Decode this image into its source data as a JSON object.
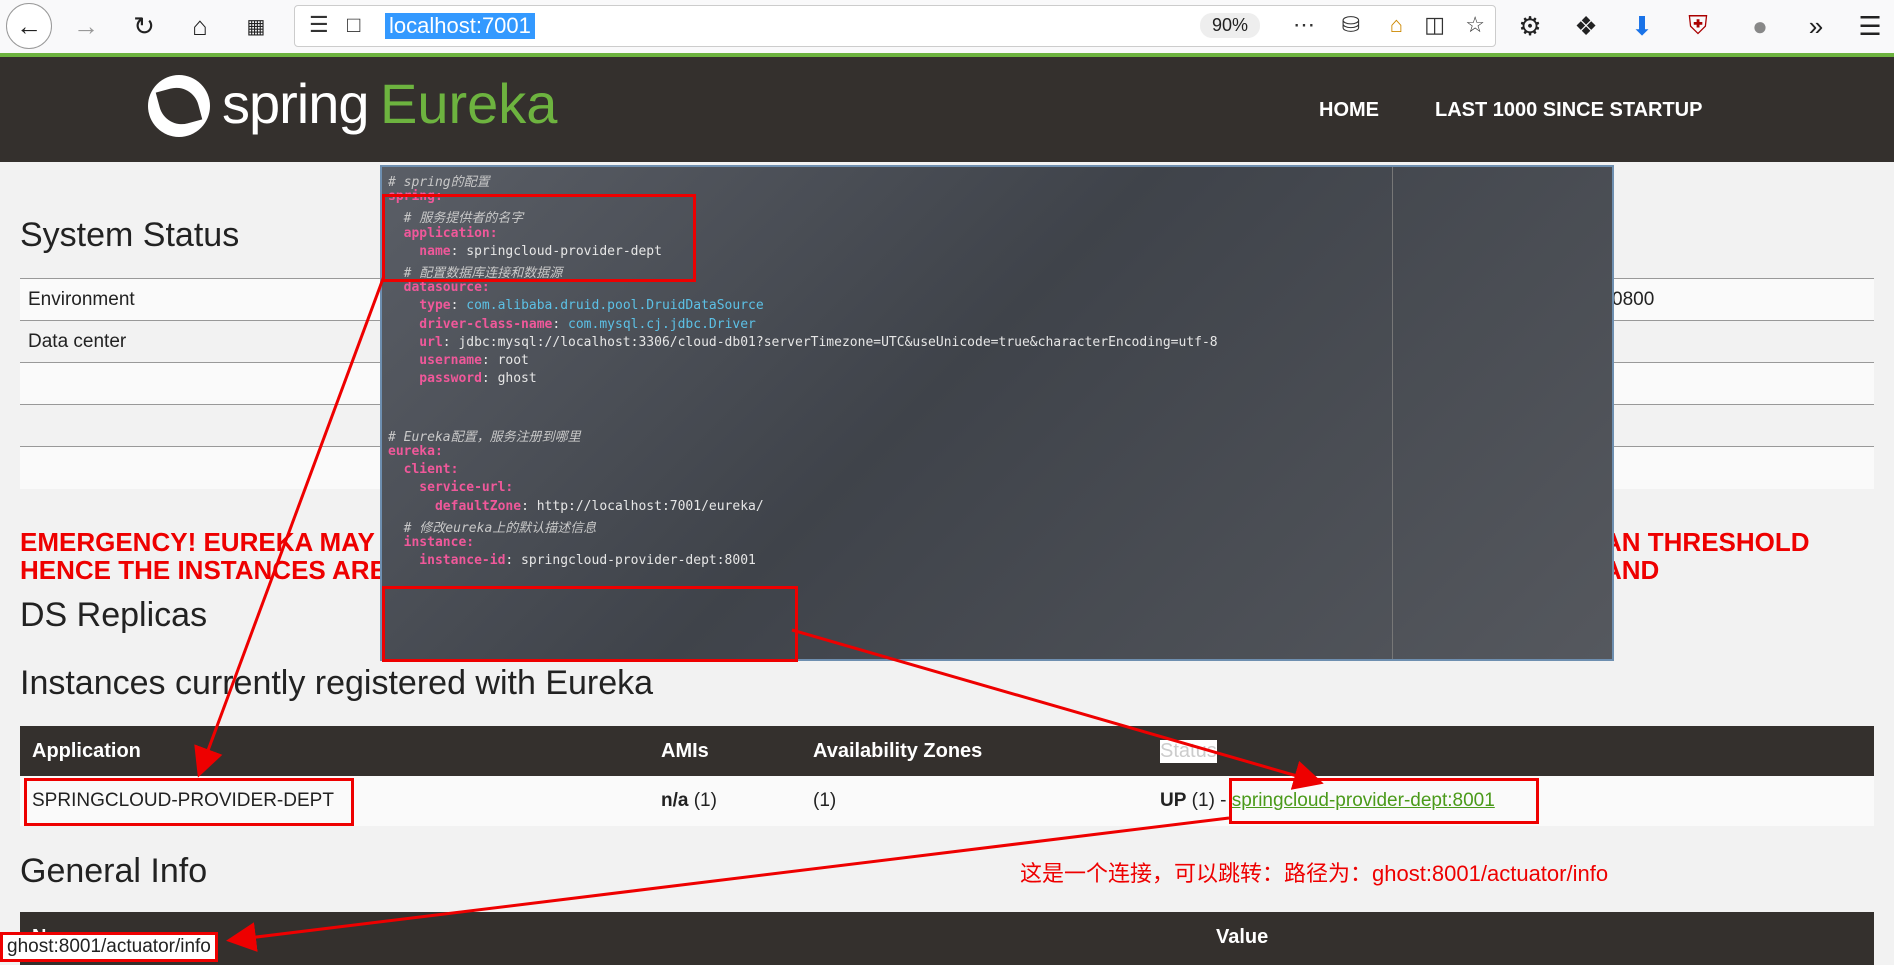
{
  "browser": {
    "url": "localhost:7001",
    "zoom": "90%"
  },
  "navbar": {
    "brand_spring": "spring",
    "brand_eureka": "Eureka",
    "links": [
      "HOME",
      "LAST 1000 SINCE STARTUP"
    ]
  },
  "system_status": {
    "title": "System Status",
    "rows": [
      {
        "label": "Environment",
        "value": "0800"
      },
      {
        "label": "Data center",
        "value": ""
      }
    ]
  },
  "emergency": {
    "line1": "EMERGENCY! EUREKA MAY E",
    "line1_right": "AN THRESHOLD AND",
    "line2": "HENCE THE INSTANCES ARE"
  },
  "ds_replicas": {
    "title": "DS Replicas"
  },
  "instances": {
    "title": "Instances currently registered with Eureka",
    "headers": [
      "Application",
      "AMIs",
      "Availability Zones",
      "Status"
    ],
    "row": {
      "application": "SPRINGCLOUD-PROVIDER-DEPT",
      "amis_bold": "n/a",
      "amis_count": " (1)",
      "zones": "(1)",
      "status_prefix": "UP",
      "status_count": " (1) - ",
      "status_link": "springcloud-provider-dept:8001"
    }
  },
  "general_info": {
    "title": "General Info",
    "headers": [
      "Name",
      "Value"
    ]
  },
  "code": [
    {
      "type": "comment",
      "text": "# spring的配置"
    },
    {
      "type": "key0",
      "text": "spring:"
    },
    {
      "type": "comment",
      "text": "  # 服务提供者的名字"
    },
    {
      "type": "key",
      "text": "  application:"
    },
    {
      "type": "kv",
      "key": "    name",
      "value": " springcloud-provider-dept"
    },
    {
      "type": "comment",
      "text": "  # 配置数据库连接和数据源"
    },
    {
      "type": "key",
      "text": "  datasource:"
    },
    {
      "type": "kvv",
      "key": "    type",
      "value": " com.alibaba.druid.pool.DruidDataSource"
    },
    {
      "type": "kvv",
      "key": "    driver-class-name",
      "value": " com.mysql.cj.jdbc.Driver"
    },
    {
      "type": "kv",
      "key": "    url",
      "value": " jdbc:mysql://localhost:3306/cloud-db01?serverTimezone=UTC&useUnicode=true&characterEncoding=utf-8"
    },
    {
      "type": "kv",
      "key": "    username",
      "value": " root"
    },
    {
      "type": "kv",
      "key": "    password",
      "value": " ghost"
    },
    {
      "type": "blank",
      "text": ""
    },
    {
      "type": "blank",
      "text": ""
    },
    {
      "type": "comment",
      "text": "# Eureka配置，服务注册到哪里"
    },
    {
      "type": "key0",
      "text": "eureka:"
    },
    {
      "type": "key",
      "text": "  client:"
    },
    {
      "type": "key",
      "text": "    service-url:"
    },
    {
      "type": "kv",
      "key": "      defaultZone",
      "value": " http://localhost:7001/eureka/"
    },
    {
      "type": "comment",
      "text": "  # 修改eureka上的默认描述信息"
    },
    {
      "type": "key",
      "text": "  instance:"
    },
    {
      "type": "kv",
      "key": "    instance-id",
      "value": " springcloud-provider-dept:8001"
    }
  ],
  "annotation_note": "这是一个连接，可以跳转：路径为：ghost:8001/actuator/info",
  "status_bar": "ghost:8001/actuator/info",
  "colors": {
    "nav_bg": "#34302d",
    "accent": "#6db33f",
    "annotation": "#e00000"
  }
}
